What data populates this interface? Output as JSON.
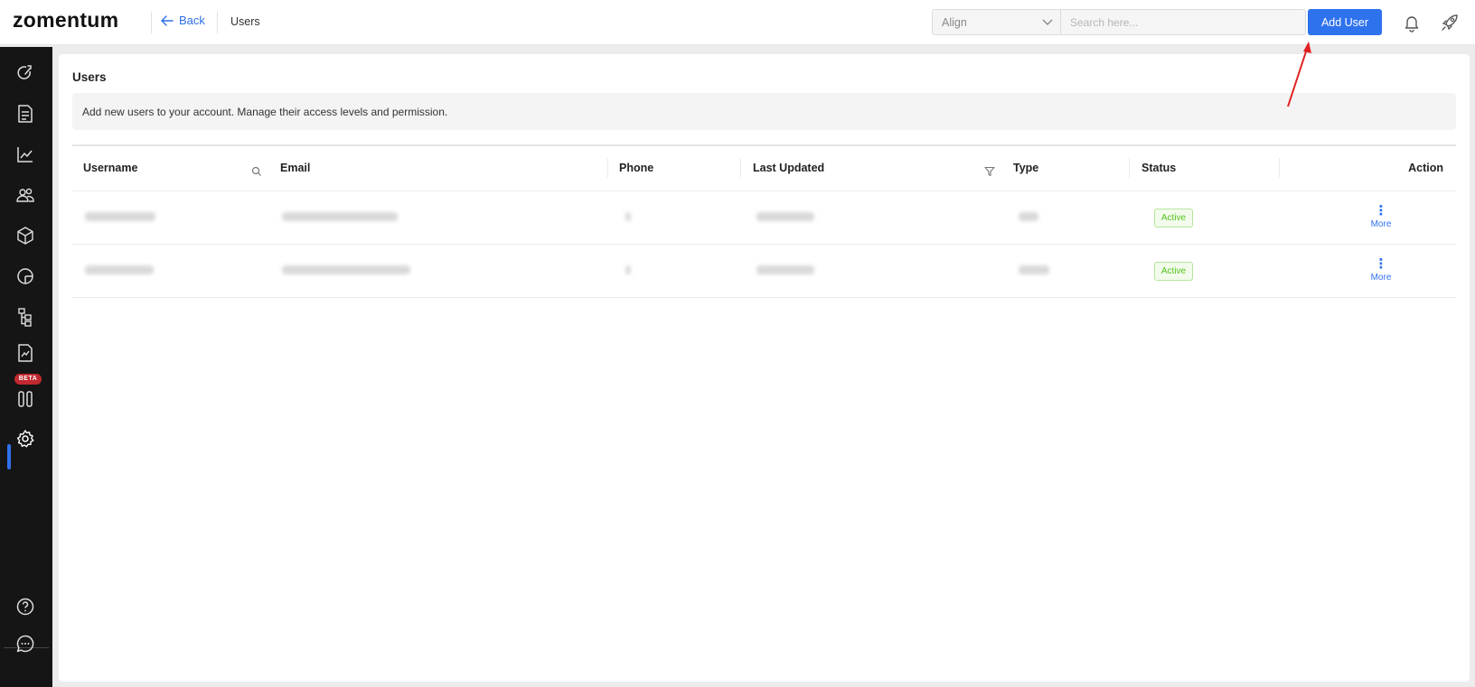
{
  "header": {
    "logo": "zomentum",
    "back_label": "Back",
    "breadcrumb": "Users",
    "select_value": "Align",
    "search_placeholder": "Search here...",
    "add_user_label": "Add User",
    "icons": [
      "arrow-left-icon",
      "chevron-down-icon",
      "bell-icon",
      "rocket-icon"
    ]
  },
  "sidebar": {
    "items": [
      {
        "name": "dashboard-icon"
      },
      {
        "name": "documents-icon"
      },
      {
        "name": "analytics-icon"
      },
      {
        "name": "clients-icon"
      },
      {
        "name": "products-icon"
      },
      {
        "name": "reports-icon"
      },
      {
        "name": "workflow-icon"
      },
      {
        "name": "templates-icon",
        "badge": "BETA"
      },
      {
        "name": "pipeline-icon"
      },
      {
        "name": "settings-icon",
        "active": true
      },
      {
        "name": "help-icon"
      },
      {
        "name": "chat-icon"
      }
    ],
    "accent": "#2f72ee"
  },
  "page": {
    "title": "Users",
    "description": "Add new users to your account. Manage their access levels and permission."
  },
  "table": {
    "columns": [
      "Username",
      "Email",
      "Phone",
      "Last Updated",
      "Type",
      "Status",
      "Action"
    ],
    "rows": [
      {
        "status": "Active",
        "action": "More"
      },
      {
        "status": "Active",
        "action": "More"
      }
    ]
  },
  "colors": {
    "primary": "#2f72ee",
    "status_active": "#52c41a",
    "beta_badge": "#c0292f",
    "annotation_arrow": "#e02020"
  }
}
